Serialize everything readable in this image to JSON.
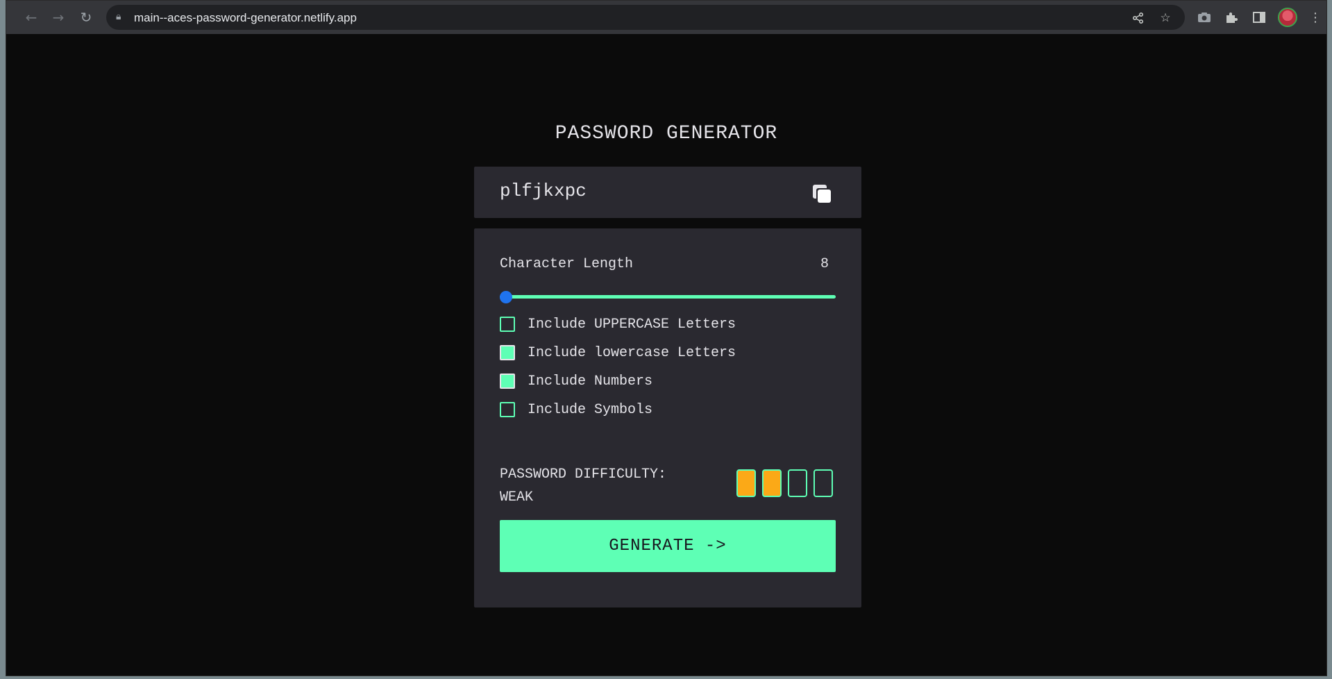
{
  "browser": {
    "url": "main--aces-password-generator.netlify.app",
    "nav_icons": [
      "arrow-left-icon",
      "arrow-right-icon",
      "reload-icon"
    ],
    "toolbar_icons": [
      "share-icon",
      "star-icon",
      "camera-icon",
      "puzzle-icon",
      "sidebar-icon",
      "avatar",
      "more-vert-icon"
    ]
  },
  "app": {
    "title": "PASSWORD GENERATOR",
    "password": "plfjkxpc",
    "length_label": "Character Length",
    "length_value": "8",
    "slider": {
      "min": 8,
      "max": 20,
      "value": 8,
      "fill_color": "#5effb5",
      "thumb_color": "#1f73ee"
    },
    "options": [
      {
        "label": "Include UPPERCASE Letters",
        "checked": false
      },
      {
        "label": "Include lowercase Letters",
        "checked": true
      },
      {
        "label": "Include Numbers",
        "checked": true
      },
      {
        "label": "Include Symbols",
        "checked": false
      }
    ],
    "difficulty_label": "PASSWORD DIFFICULTY:",
    "difficulty_value": "WEAK",
    "difficulty_level": 2,
    "difficulty_max": 4,
    "difficulty_color": "#fba917",
    "generate_label": "GENERATE ->",
    "accent_color": "#5effb5",
    "background_color": "#0b0b0b",
    "panel_color": "#2a2930"
  }
}
